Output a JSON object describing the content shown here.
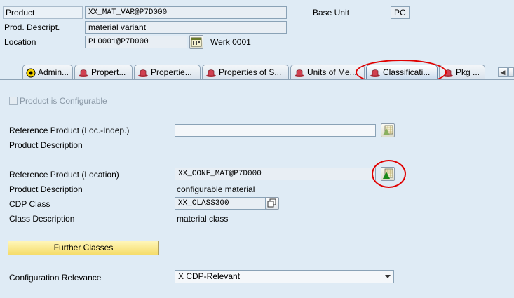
{
  "header": {
    "product_label": "Product",
    "product_value": "XX_MAT_VAR@P7D000",
    "base_unit_label": "Base Unit",
    "base_unit_value": "PC",
    "prod_descript_label": "Prod. Descript.",
    "prod_descript_value": "material variant",
    "location_label": "Location",
    "location_value": "PL0001@P7D000",
    "location_desc": "Werk 0001"
  },
  "tabs": [
    {
      "label": "Admin...",
      "icon": "admin-icon"
    },
    {
      "label": "Propert...",
      "icon": "hat-icon"
    },
    {
      "label": "Propertie...",
      "icon": "hat-icon"
    },
    {
      "label": "Properties of S...",
      "icon": "hat-icon"
    },
    {
      "label": "Units of Me...",
      "icon": "hat-icon"
    },
    {
      "label": "Classificati...",
      "icon": "hat-icon",
      "active": true
    },
    {
      "label": "Pkg ...",
      "icon": "hat-icon"
    }
  ],
  "classification": {
    "configurable_label": "Product is Configurable",
    "ref_product_locindep_label": "Reference Product (Loc.-Indep.)",
    "ref_product_locindep_value": "",
    "product_description_label_1": "Product Description",
    "ref_product_location_label": "Reference Product (Location)",
    "ref_product_location_value": "XX_CONF_MAT@P7D000",
    "product_description_label_2": "Product Description",
    "product_description_value_2": "configurable material",
    "cdp_class_label": "CDP Class",
    "cdp_class_value": "XX_CLASS300",
    "class_description_label": "Class Description",
    "class_description_value": "material class",
    "further_classes_button": "Further Classes",
    "config_relevance_label": "Configuration Relevance",
    "config_relevance_value": "X CDP-Relevant"
  },
  "colors": {
    "background": "#dfebf5",
    "highlight": "#e00000",
    "button_yellow": "#f5dc6a"
  }
}
